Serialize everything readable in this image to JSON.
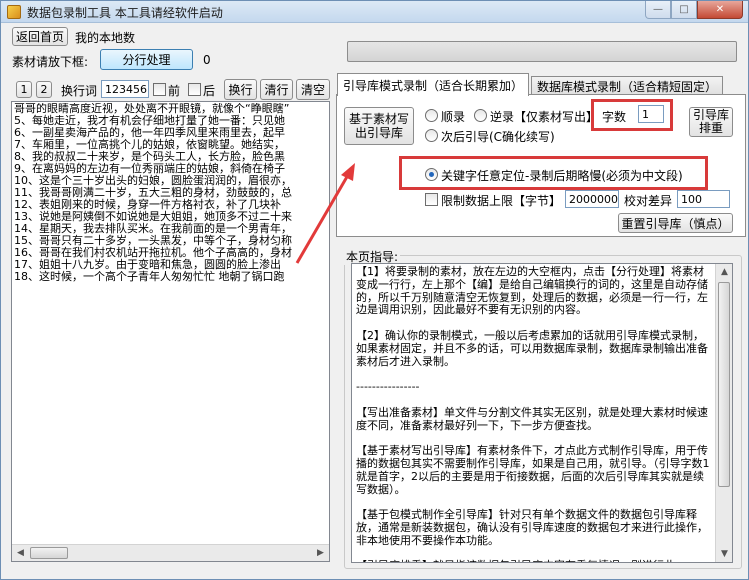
{
  "window": {
    "title": "数据包录制工具  本工具请经软件启动"
  },
  "toolbar": {
    "back_home": "返回首页",
    "my_local": "我的本地数",
    "material_label": "素材请放下框:",
    "split_button": "分行处理",
    "split_count": "0",
    "btn_1": "1",
    "btn_2": "2",
    "replace_word_label": "换行词",
    "replace_word_value": "123456",
    "front_label": "前",
    "back_label": "后",
    "newline_button": "换行",
    "clear_line_button": "清行",
    "clear_empty_button": "清空"
  },
  "left_text": [
    "哥哥的眼睛高度近视，处处离不开眼镜，就像个“睁眼瞎”",
    "5、每她走近，我才有机会仔细地打量了她一番：只见她",
    "6、一副星卖海产品的，他一年四季风里来雨里去，起早",
    "7、车厢里，一位高挑个儿的姑娘，依窗眺望。她结实，",
    "8、我的叔叔二十来岁，是个码头工人，长方脸，脸色黑",
    "9、在离妈妈的左边有一位秀丽端庄的姑娘，斜倚在椅子",
    "10、这是个三十岁出头的妇娘，圆脸蛋润润的，眉很亦，",
    "11、我哥哥刚满二十岁，五大三粗的身材，劲鼓鼓的，总",
    "12、表姐刚来的时候，身穿一件方格衬衣，补了几块补",
    "13、说她是阿姨倒不如说她是大姐姐，她顶多不过二十来",
    "14、星期天，我去排队买米。在我前面的是一个男青年，",
    "15、哥哥只有二十多岁，一头黑发，中等个子，身材匀称",
    "16、哥哥在我们村农机站开拖拉机。他个子高高的，身材",
    "17、姐姐十八九岁。由于变暗和焦急，圆圆的脸上渗出",
    "18、这时候，一个高个子青年人匆匆忙忙  地朝了锅口跑"
  ],
  "tabs": {
    "active": "引导库模式录制（适合长期累加）",
    "inactive": "数据库模式录制（适合精短固定）"
  },
  "panel": {
    "build_button": "基于素材写出引导库",
    "radio_forward": "顺录",
    "radio_reverse": "逆录【仅素材写出】",
    "radio_next": "次后引导(C确化续写)",
    "char_count_label": "字数",
    "char_count_value": "1",
    "sort_button": "引导库排重",
    "radio_keyword": "关键字任意定位-录制后期略慢(必须为中文段)",
    "limit_label": "限制数据上限【字节】",
    "limit_value": "2000000",
    "deviation_label": "校对差异",
    "deviation_value": "100",
    "reset_button": "重置引导库（慎点）"
  },
  "guide": {
    "title": "本页指导:",
    "paragraphs": [
      "【1】将要录制的素材，放在左边的大空框内，点击【分行处理】将素材变成一行行，左上那个【编】是给自己编辑换行的词的，这里是自动存储的，所以千万别随意清空无恢复到，处理后的数据，必须是一行一行，左边是调用识别，因此最好不要有无识别的内容。",
      "【2】确认你的录制模式，一般以后考虑累加的话就用引导库模式录制，如果素材固定，并且不多的话，可以用数据库录制，数据库录制输出准备素材后才进入录制。",
      "----------------",
      "【写出准备素材】单文件与分割文件其实无区别，就是处理大素材时候速度不同，准备素材最好列一下，下一步方便查找。",
      "【基于素材写出引导库】有素材条件下，才点此方式制作引导库，用于传播的数据包其实不需要制作引导库，如果是自己用，就引导。（引导字数1就是首字，2以后的主要是用于衔接数据，后面的次后引导库其实就是续写数据）。",
      "【基于包模式制作全引导库】针对只有单个数据文件的数据包引导库释放，通常是新装数据包，确认没有引导库速度的数据包才来进行此操作，非本地使用不要操作本功能。",
      "【引导库排重】就是指该数据包引导库内容有重复情况，则进行此"
    ]
  },
  "colors": {
    "highlight": "#d83a3a",
    "arrow": "#e23a3a"
  }
}
